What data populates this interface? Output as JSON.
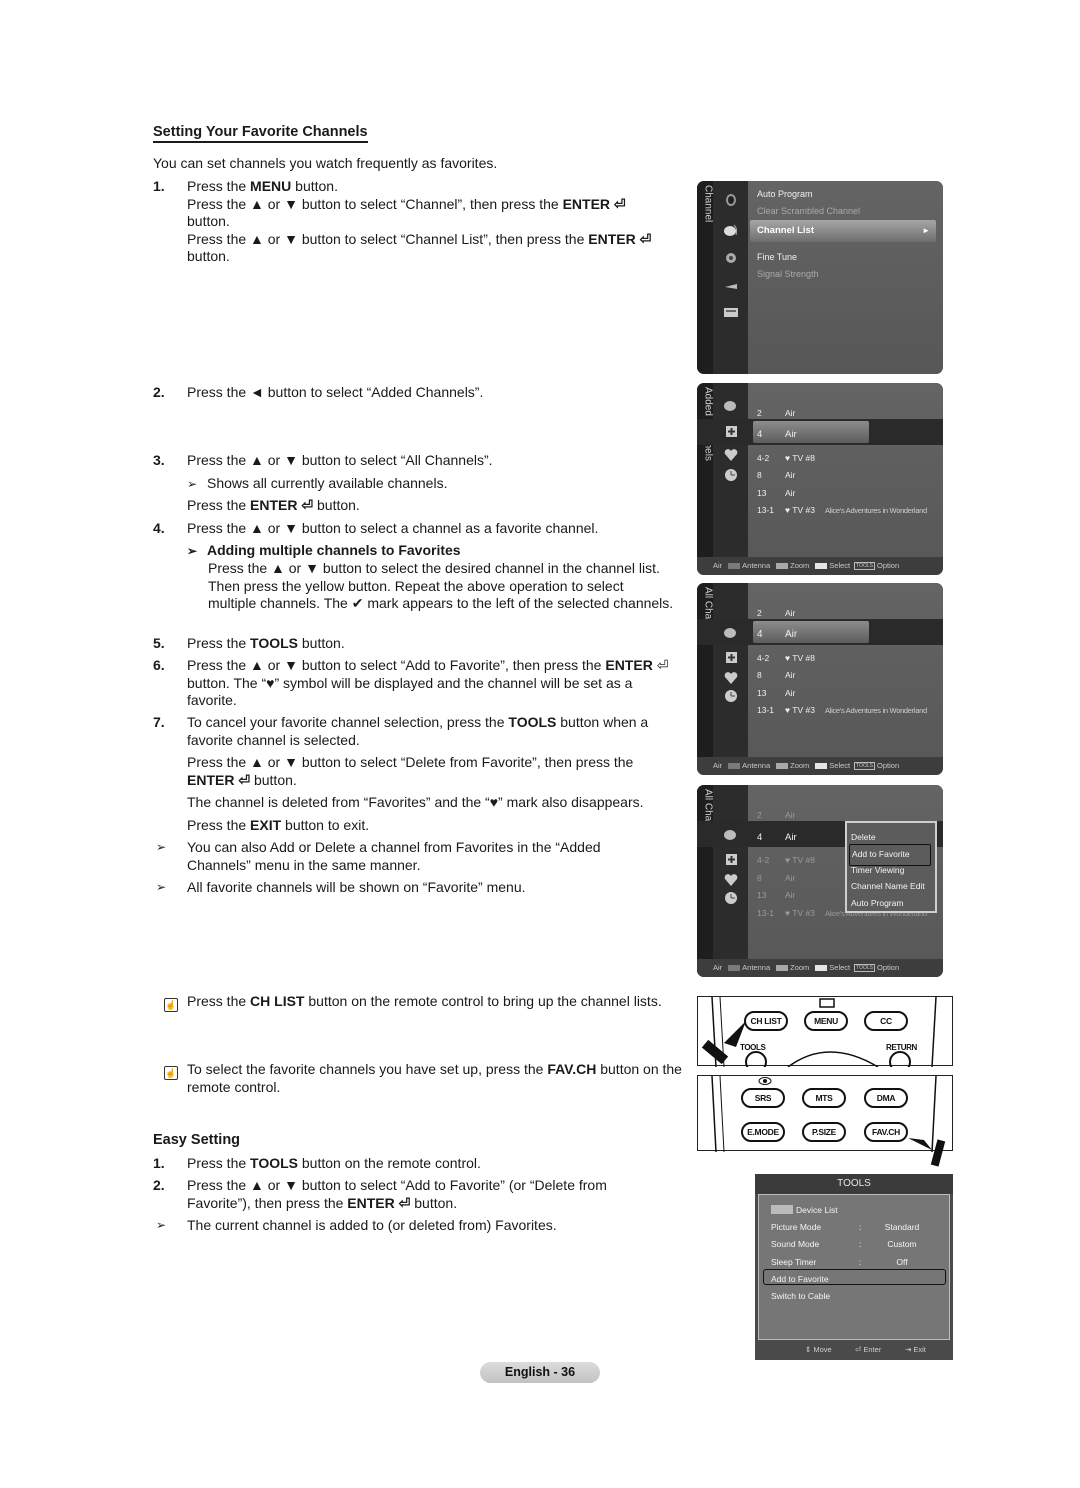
{
  "section": {
    "title": "Setting Your Favorite Channels",
    "intro": "You can set channels you watch frequently as favorites."
  },
  "steps": [
    {
      "num": "1.",
      "lines": [
        [
          "Press the ",
          "MENU",
          " button."
        ],
        [
          "Press the ▲ or ▼ button to select “Channel”, then press the ",
          "ENTER ⏎",
          ""
        ],
        [
          "button.",
          "",
          ""
        ],
        [
          "Press the ▲ or ▼ button to select “Channel List”, then press the ",
          "ENTER ⏎",
          ""
        ],
        [
          "button.",
          "",
          ""
        ]
      ]
    },
    {
      "num": "2.",
      "text": "Press the ◄ button to select “Added Channels”."
    },
    {
      "num": "3.",
      "text": "Press the ▲ or ▼ button to select “All Channels”.",
      "note": "Shows all currently available channels.",
      "enter_pre": "Press the ",
      "enter_bold": "ENTER ⏎",
      "enter_post": " button."
    },
    {
      "num": "4.",
      "text": "Press the ▲ or ▼ button to select a channel as a favorite channel.",
      "sub_title": "Adding multiple channels to Favorites",
      "sub_text": "Press the ▲ or ▼ button to select the desired channel in the channel list. Then press the yellow button. Repeat the above operation to select multiple channels. The ✔ mark appears to the left of the selected channels."
    },
    {
      "num": "5.",
      "pre": "Press the ",
      "bold": "TOOLS",
      "post": " button."
    },
    {
      "num": "6.",
      "pre": "Press the ▲ or ▼ button to select “Add to Favorite”, then press the ",
      "bold": "ENTER",
      "post": " ⏎ button. The “♥” symbol will be displayed and the channel will be set as a favorite."
    },
    {
      "num": "7.",
      "pre": "To cancel your favorite channel selection, press the ",
      "bold": "TOOLS",
      "post": " button when a favorite channel is selected.",
      "p2_pre": "Press the ▲ or ▼ button to select “Delete from Favorite”, then press the ",
      "p2_bold": "ENTER ⏎",
      "p2_post": " button.",
      "p3": "The channel is deleted from “Favorites” and the “♥” mark also disappears.",
      "p4_pre": "Press the ",
      "p4_bold": "EXIT",
      "p4_post": " button to exit."
    }
  ],
  "notes": [
    "You can also Add or Delete a channel from Favorites in the “Added Channels” menu in the same manner.",
    "All favorite channels will be shown on “Favorite” menu."
  ],
  "tips": [
    {
      "pre": "Press the ",
      "bold": "CH LIST",
      "post": " button on the remote control to bring up the channel lists."
    },
    {
      "pre": "To select the favorite channels you have set up, press the ",
      "bold": "FAV.CH",
      "post": " button on the remote control."
    }
  ],
  "easy": {
    "title": "Easy Setting",
    "s1_pre": "Press the ",
    "s1_bold": "TOOLS",
    "s1_post": " button on the remote control.",
    "s2_pre": "Press the ▲ or ▼ button to select “Add to Favorite” (or “Delete from Favorite”), then press the ",
    "s2_bold": "ENTER ⏎",
    "s2_post": " button.",
    "note": "The current channel is added to (or deleted from) Favorites."
  },
  "screen1": {
    "side_label": "Channel",
    "items": [
      "Auto Program",
      "Clear Scrambled Channel",
      "Channel List",
      "Fine Tune",
      "Signal Strength"
    ],
    "selected_arrow": "►"
  },
  "channel_list": [
    {
      "num": "2",
      "source": "Air",
      "program": ""
    },
    {
      "num": "4",
      "source": "Air",
      "program": ""
    },
    {
      "num": "4-2",
      "source": "♥ TV #8",
      "program": ""
    },
    {
      "num": "8",
      "source": "Air",
      "program": ""
    },
    {
      "num": "13",
      "source": "Air",
      "program": ""
    },
    {
      "num": "13-1",
      "source": "♥ TV #3",
      "program": "Alice’s Adventures in Wonderland"
    }
  ],
  "screen2": {
    "side_label": "Added Channels"
  },
  "screen3": {
    "side_label": "All Channels"
  },
  "screen4": {
    "side_label": "All Channels",
    "popup": [
      "Delete",
      "Add to Favorite",
      "Timer Viewing",
      "Channel Name Edit",
      "Auto Program"
    ]
  },
  "footer": {
    "air": "Air",
    "antenna": "Antenna",
    "zoom": "Zoom",
    "select": "Select",
    "tools_icon": "TOOLS",
    "option": "Option",
    "colors": {
      "antenna": "#7a7a7a",
      "zoom": "#a8a8a8",
      "select": "#e4e4e4"
    }
  },
  "remote": {
    "top": [
      "CH LIST",
      "MENU",
      "CC"
    ],
    "tools_label": "TOOLS",
    "return_label": "RETURN",
    "bottom_row1": [
      "SRS",
      "MTS",
      "DMA"
    ],
    "bottom_row2": [
      "E.MODE",
      "P.SIZE",
      "FAV.CH"
    ]
  },
  "tools_menu": {
    "title": "TOOLS",
    "device_list": "Device List",
    "rows": [
      {
        "label": "Picture Mode",
        "value": "Standard"
      },
      {
        "label": "Sound Mode",
        "value": "Custom"
      },
      {
        "label": "Sleep Timer",
        "value": "Off"
      }
    ],
    "add_fav": "Add to Favorite",
    "switch": "Switch to Cable",
    "foot_move": "Move",
    "foot_enter": "Enter",
    "foot_exit": "Exit"
  },
  "page": "English - 36"
}
